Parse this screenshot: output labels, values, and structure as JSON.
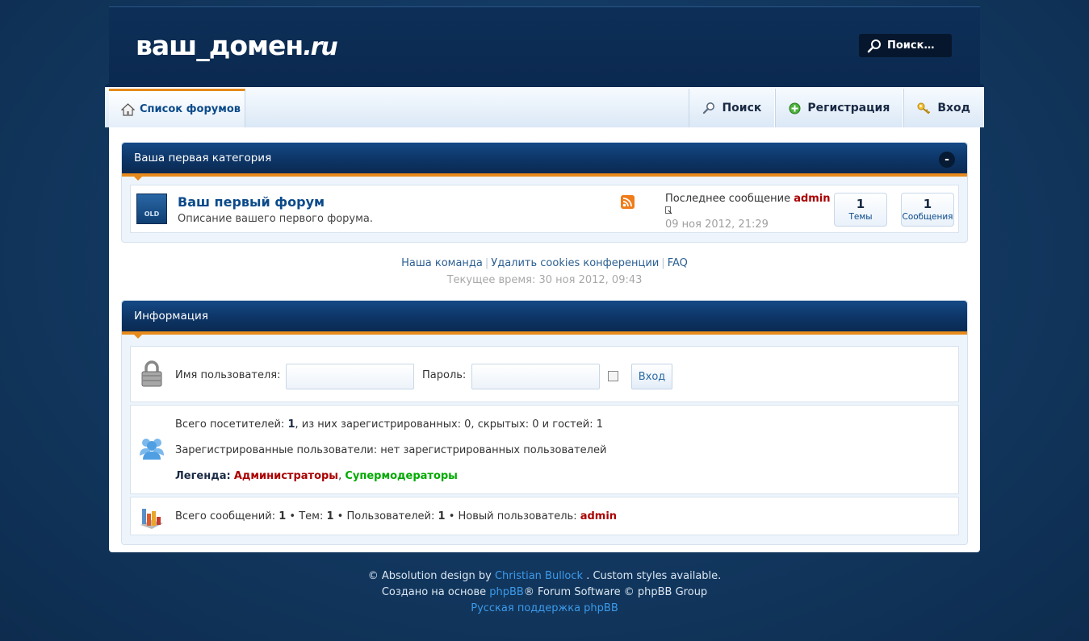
{
  "header": {
    "logo_main": "ваш_домен",
    "logo_tld": ".ru",
    "search_label": "Поиск…"
  },
  "nav": {
    "home_label": "Список форумов",
    "search_label": "Поиск",
    "register_label": "Регистрация",
    "login_label": "Вход"
  },
  "category": {
    "title": "Ваша первая категория",
    "collapse_symbol": "-",
    "forum": {
      "icon_text": "OLD",
      "title": "Ваш первый форум",
      "description": "Описание вашего первого форума.",
      "lastpost_label": "Последнее сообщение",
      "lastpost_user": "admin",
      "lastpost_date": "09 ноя 2012, 21:29",
      "topics_count": "1",
      "topics_label": "Темы",
      "posts_count": "1",
      "posts_label": "Сообщения"
    }
  },
  "links": {
    "team": "Наша команда",
    "delete_cookies": "Удалить cookies конференции",
    "faq": "FAQ",
    "current_time": "Текущее время: 30 ноя 2012, 09:43"
  },
  "info": {
    "title": "Информация",
    "login": {
      "username_label": "Имя пользователя:",
      "username_value": "",
      "password_label": "Пароль:",
      "password_value": "",
      "button_label": "Вход"
    },
    "online": {
      "total_prefix": "Всего посетителей: ",
      "total_count": "1",
      "total_suffix": ", из них зарегистрированных: 0, скрытых: 0 и гостей: 1",
      "registered_line": "Зарегистрированные пользователи: нет зарегистрированных пользователей",
      "legend_label": "Легенда:",
      "legend_admins": "Администраторы",
      "legend_sep": ",",
      "legend_smods": "Супермодераторы"
    },
    "stats": {
      "posts_label": "Всего сообщений:",
      "posts_value": "1",
      "topics_label": "Тем:",
      "topics_value": "1",
      "users_label": "Пользователей:",
      "users_value": "1",
      "newest_label": "Новый пользователь:",
      "newest_value": "admin"
    }
  },
  "footer": {
    "line1_prefix": "© Absolution design by",
    "line1_link": "Christian Bullock",
    "line1_suffix": ". Custom styles available.",
    "line2_prefix": "Создано на основе",
    "line2_link": "phpBB",
    "line2_suffix": "® Forum Software © phpBB Group",
    "line3_link": "Русская поддержка phpBB"
  },
  "colors": {
    "accent_orange": "#e78a1c",
    "header_navy": "#0b2950",
    "admin_red": "#aa0000",
    "smod_green": "#00aa00",
    "link_blue": "#0b4a8a"
  }
}
